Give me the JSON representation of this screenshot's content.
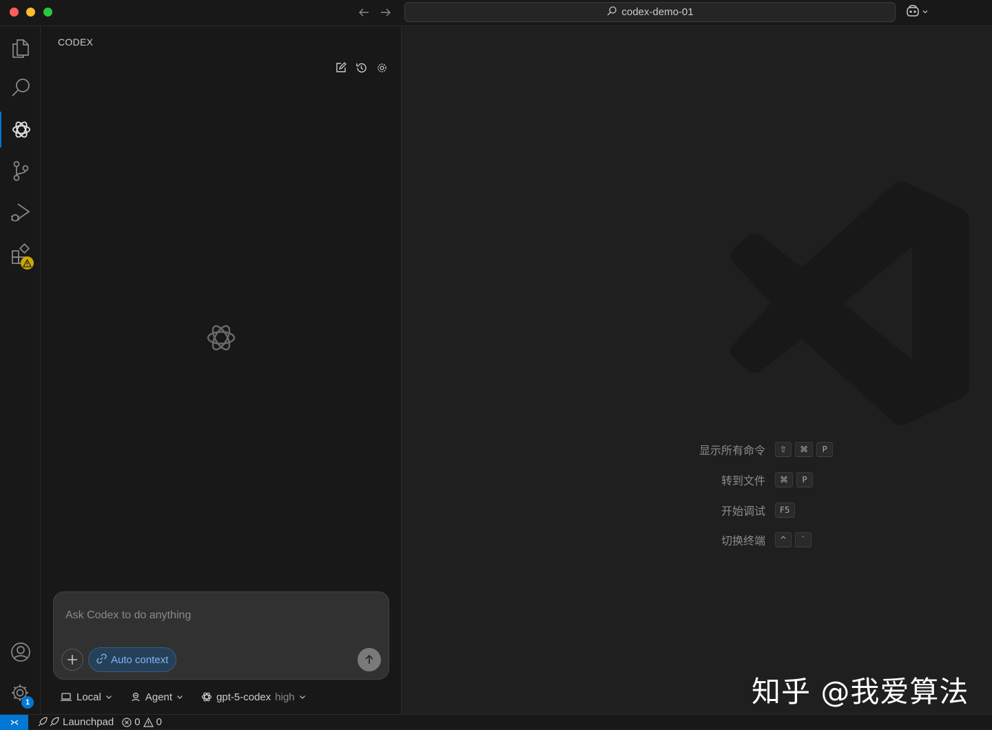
{
  "window": {
    "search_text": "codex-demo-01"
  },
  "activity_bar": {
    "items": [
      "explorer-icon",
      "search-icon",
      "codex-icon",
      "source-control-icon",
      "run-debug-icon",
      "extensions-icon"
    ],
    "settings_badge": "1"
  },
  "sidebar": {
    "title": "CODEX",
    "composer": {
      "placeholder": "Ask Codex to do anything",
      "auto_context_label": "Auto context"
    },
    "footer": {
      "location_label": "Local",
      "mode_label": "Agent",
      "model_label": "gpt-5-codex",
      "effort_label": "high"
    }
  },
  "editor": {
    "shortcuts": [
      {
        "label": "显示所有命令",
        "keys": [
          "⇧",
          "⌘",
          "P"
        ]
      },
      {
        "label": "转到文件",
        "keys": [
          "⌘",
          "P"
        ]
      },
      {
        "label": "开始调试",
        "keys": [
          "F5"
        ]
      },
      {
        "label": "切换终端",
        "keys": [
          "^",
          "`"
        ]
      }
    ],
    "watermark_text": "知乎 @我爱算法"
  },
  "status_bar": {
    "launchpad_label": "Launchpad",
    "errors_count": "0",
    "warnings_count": "0"
  },
  "colors": {
    "accent": "#0078d4",
    "warning": "#cca700",
    "background": "#1f1f1f",
    "sidebar_bg": "#181818"
  }
}
